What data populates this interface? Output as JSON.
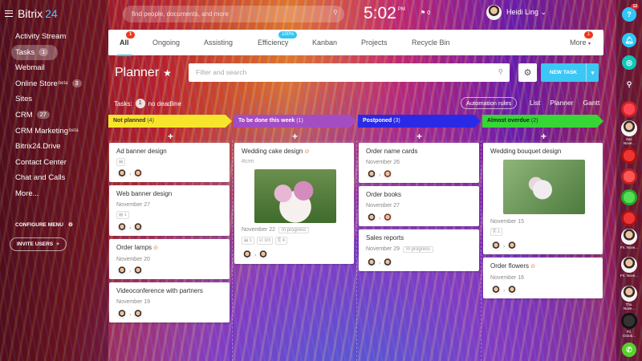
{
  "app": {
    "logo_a": "Bitrix",
    "logo_b": "24"
  },
  "topbar": {
    "search_placeholder": "find people, documents, and more",
    "time": "5:02",
    "ampm": "PM",
    "flag_count": "0",
    "user": "Heidi Ling ⌄"
  },
  "sidebar": {
    "items": [
      {
        "label": "Activity Stream"
      },
      {
        "label": "Tasks",
        "count": "1"
      },
      {
        "label": "Webmail"
      },
      {
        "label": "Online Store",
        "beta": "beta",
        "count": "3"
      },
      {
        "label": "Sites"
      },
      {
        "label": "CRM",
        "count": "27"
      },
      {
        "label": "CRM Marketing",
        "beta": "beta"
      },
      {
        "label": "Bitrix24.Drive"
      },
      {
        "label": "Contact Center"
      },
      {
        "label": "Chat and Calls"
      },
      {
        "label": "More..."
      }
    ],
    "configure": "CONFIGURE MENU",
    "invite": "INVITE USERS"
  },
  "tabs": [
    {
      "label": "All",
      "badge": "1"
    },
    {
      "label": "Ongoing"
    },
    {
      "label": "Assisting"
    },
    {
      "label": "Efficiency",
      "badge": "100%"
    },
    {
      "label": "Kanban"
    },
    {
      "label": "Projects"
    },
    {
      "label": "Recycle Bin"
    },
    {
      "label": "More",
      "badge": "1"
    }
  ],
  "planner": {
    "title": "Planner",
    "star": "★",
    "filter_placeholder": "Filter and search",
    "new_task": "NEW TASK",
    "tasks_label": "Tasks:",
    "tasks_count": "1",
    "no_deadline": "no deadline",
    "automation": "Automation rules",
    "views": [
      "List",
      "Planner",
      "Gantt"
    ]
  },
  "columns": [
    {
      "title": "Not planned",
      "count": "(4)",
      "color": "#f7e52b"
    },
    {
      "title": "To be done this week",
      "count": "(1)",
      "color": "#a44dc3"
    },
    {
      "title": "Postponed",
      "count": "(3)",
      "color": "#2a2ae6"
    },
    {
      "title": "Almost overdue",
      "count": "(2)",
      "color": "#35d635"
    }
  ],
  "cards": {
    "c1": {
      "title": "Ad banner design"
    },
    "c2": {
      "title": "Web banner design",
      "date": "November 27",
      "icon": "▤ 1"
    },
    "c3": {
      "title": "Order lamps",
      "date": "November 20"
    },
    "c4": {
      "title": "Videoconference with partners",
      "date": "November 19"
    },
    "c5": {
      "title": "Wedding cake design",
      "tag": "#crm",
      "date": "November 22",
      "status": "In progress",
      "i1": "▤ 1",
      "i2": "☑ 3/3",
      "i3": "⎘ 4"
    },
    "c6": {
      "title": "Order name cards",
      "date": "November 26"
    },
    "c7": {
      "title": "Order books",
      "date": "November 27"
    },
    "c8": {
      "title": "Sales reports",
      "date": "November 29",
      "status": "In progress"
    },
    "c9": {
      "title": "Wedding bouquet design",
      "date": "November 15",
      "icon": "⎘ 1"
    },
    "c10": {
      "title": "Order flowers",
      "date": "November 16"
    }
  },
  "rightbar": {
    "help_badge": "12",
    "people": [
      "Sat. Nove...",
      "",
      "",
      "",
      "Fri. Nove...",
      "",
      "Fri. Nove...",
      "Thu. Nove...",
      "Fri. Octob..."
    ]
  },
  "colors": {
    "accent": "#2fc6f6",
    "badge": "#f0371b",
    "fire": "#f36b1c"
  }
}
